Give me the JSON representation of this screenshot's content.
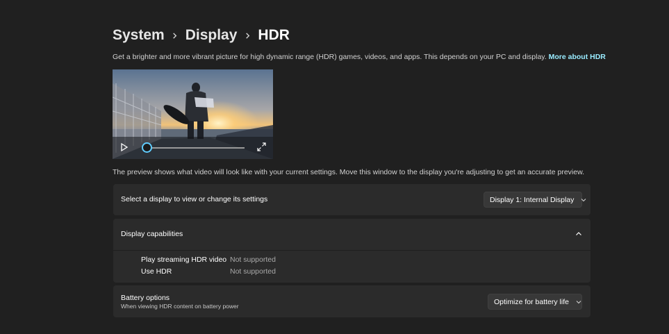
{
  "breadcrumb": {
    "items": [
      "System",
      "Display",
      "HDR"
    ]
  },
  "description": {
    "text": "Get a brighter and more vibrant picture for high dynamic range (HDR) games, videos, and apps. This depends on your PC and display.",
    "link": "More about HDR"
  },
  "video": {
    "progress": 0.0,
    "icons": [
      "play-icon",
      "fullscreen-icon"
    ]
  },
  "preview_note": "The preview shows what video will look like with your current settings. Move this window to the display you're adjusting to get an accurate preview.",
  "select_display": {
    "label": "Select a display to view or change its settings",
    "value": "Display 1: Internal Display"
  },
  "capabilities": {
    "title": "Display capabilities",
    "rows": [
      {
        "name": "Play streaming HDR video",
        "value": "Not supported"
      },
      {
        "name": "Use HDR",
        "value": "Not supported"
      }
    ]
  },
  "battery": {
    "title": "Battery options",
    "subtitle": "When viewing HDR content on battery power",
    "value": "Optimize for battery life"
  },
  "colors": {
    "background": "#202020",
    "card": "#2b2b2b",
    "accent": "#60cdff",
    "link": "#99ebff"
  }
}
